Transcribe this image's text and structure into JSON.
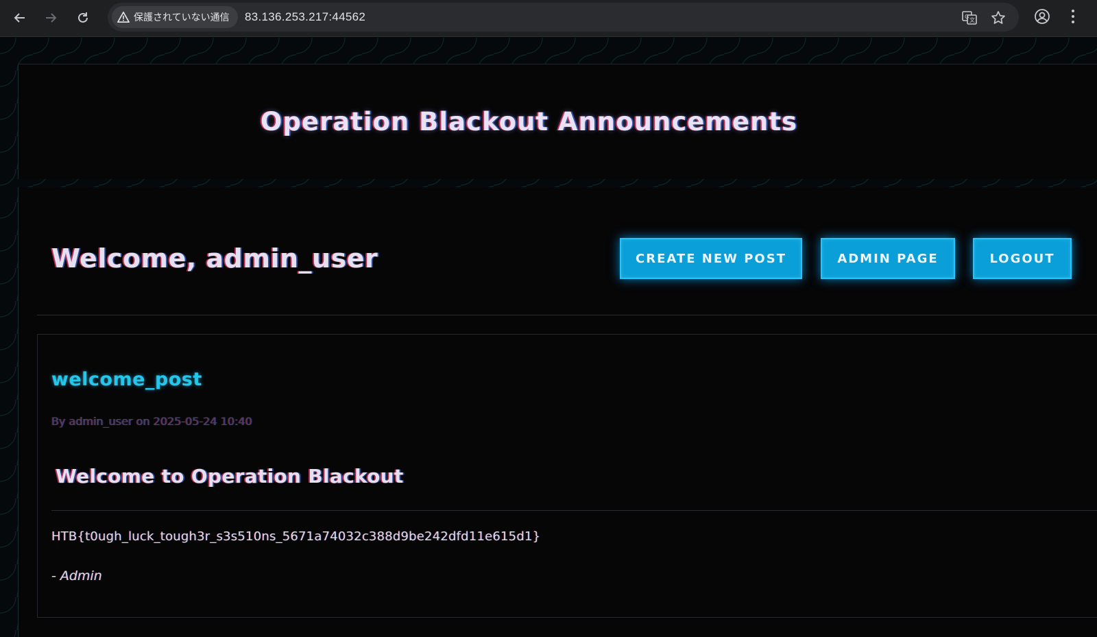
{
  "browser": {
    "security_label": "保護されていない通信",
    "url": "83.136.253.217:44562"
  },
  "site": {
    "title": "Operation Blackout Announcements"
  },
  "dashboard": {
    "welcome": "Welcome, admin_user",
    "buttons": {
      "create": "CREATE NEW POST",
      "admin": "ADMIN PAGE",
      "logout": "LOGOUT"
    }
  },
  "post": {
    "title": "welcome_post",
    "meta": "By admin_user on 2025-05-24 10:40",
    "heading": "Welcome to Operation Blackout",
    "body": "HTB{t0ugh_luck_tough3r_s3s510ns_5671a74032c388d9be242dfd11e615d1}",
    "signature": "- Admin"
  },
  "colors": {
    "accent": "#0a9fd8",
    "post_title": "#22c7ec",
    "background": "#060607"
  }
}
